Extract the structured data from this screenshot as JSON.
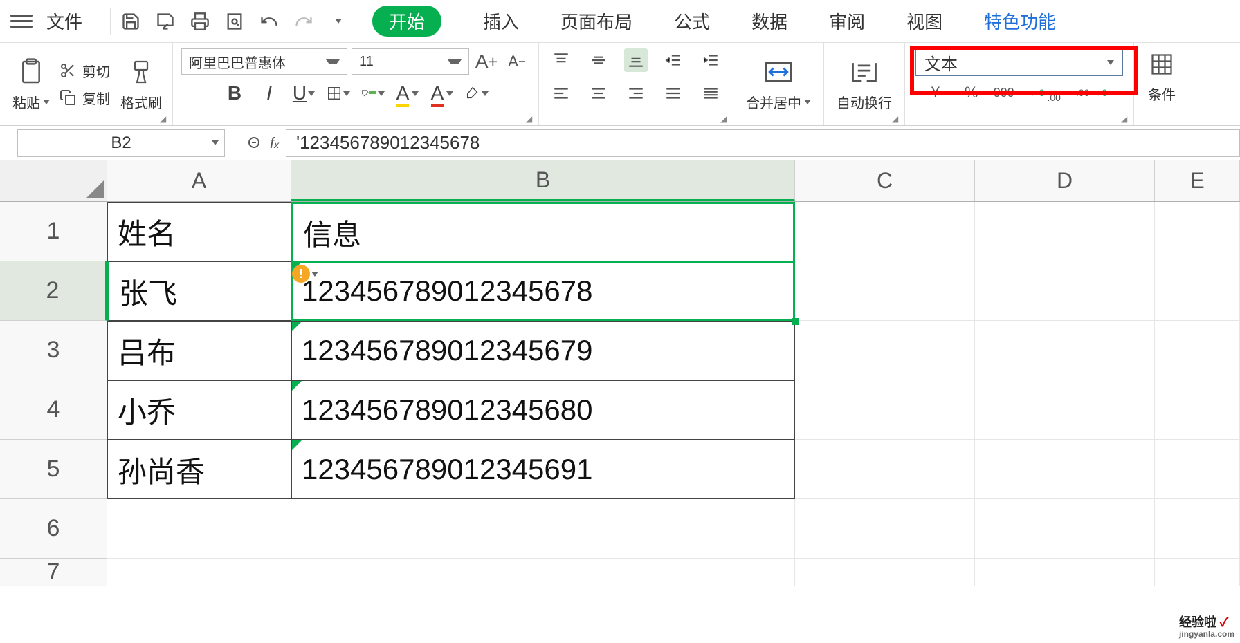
{
  "menubar": {
    "file": "文件",
    "tabs": {
      "start": "开始",
      "insert": "插入",
      "page_layout": "页面布局",
      "formula": "公式",
      "data": "数据",
      "review": "审阅",
      "view": "视图",
      "special": "特色功能"
    }
  },
  "ribbon": {
    "paste": "粘贴",
    "cut": "剪切",
    "copy": "复制",
    "format_painter": "格式刷",
    "font_name": "阿里巴巴普惠体",
    "font_size": "11",
    "merge": "合并居中",
    "wrap": "自动换行",
    "number_format": "文本",
    "conditional": "条件"
  },
  "formula_bar": {
    "name_box": "B2",
    "formula": "'123456789012345678"
  },
  "columns": {
    "A": "A",
    "B": "B",
    "C": "C",
    "D": "D",
    "E": "E"
  },
  "rows": {
    "r1": "1",
    "r2": "2",
    "r3": "3",
    "r4": "4",
    "r5": "5",
    "r6": "6",
    "r7": "7"
  },
  "cells": {
    "A1": "姓名",
    "B1": "信息",
    "A2": "张飞",
    "B2": "123456789012345678",
    "A3": "吕布",
    "B3": "123456789012345679",
    "A4": "小乔",
    "B4": "123456789012345680",
    "A5": "孙尚香",
    "B5": "123456789012345691"
  },
  "watermark": {
    "text": "经验啦",
    "check": "✓",
    "sub": "jingyanla.com"
  }
}
